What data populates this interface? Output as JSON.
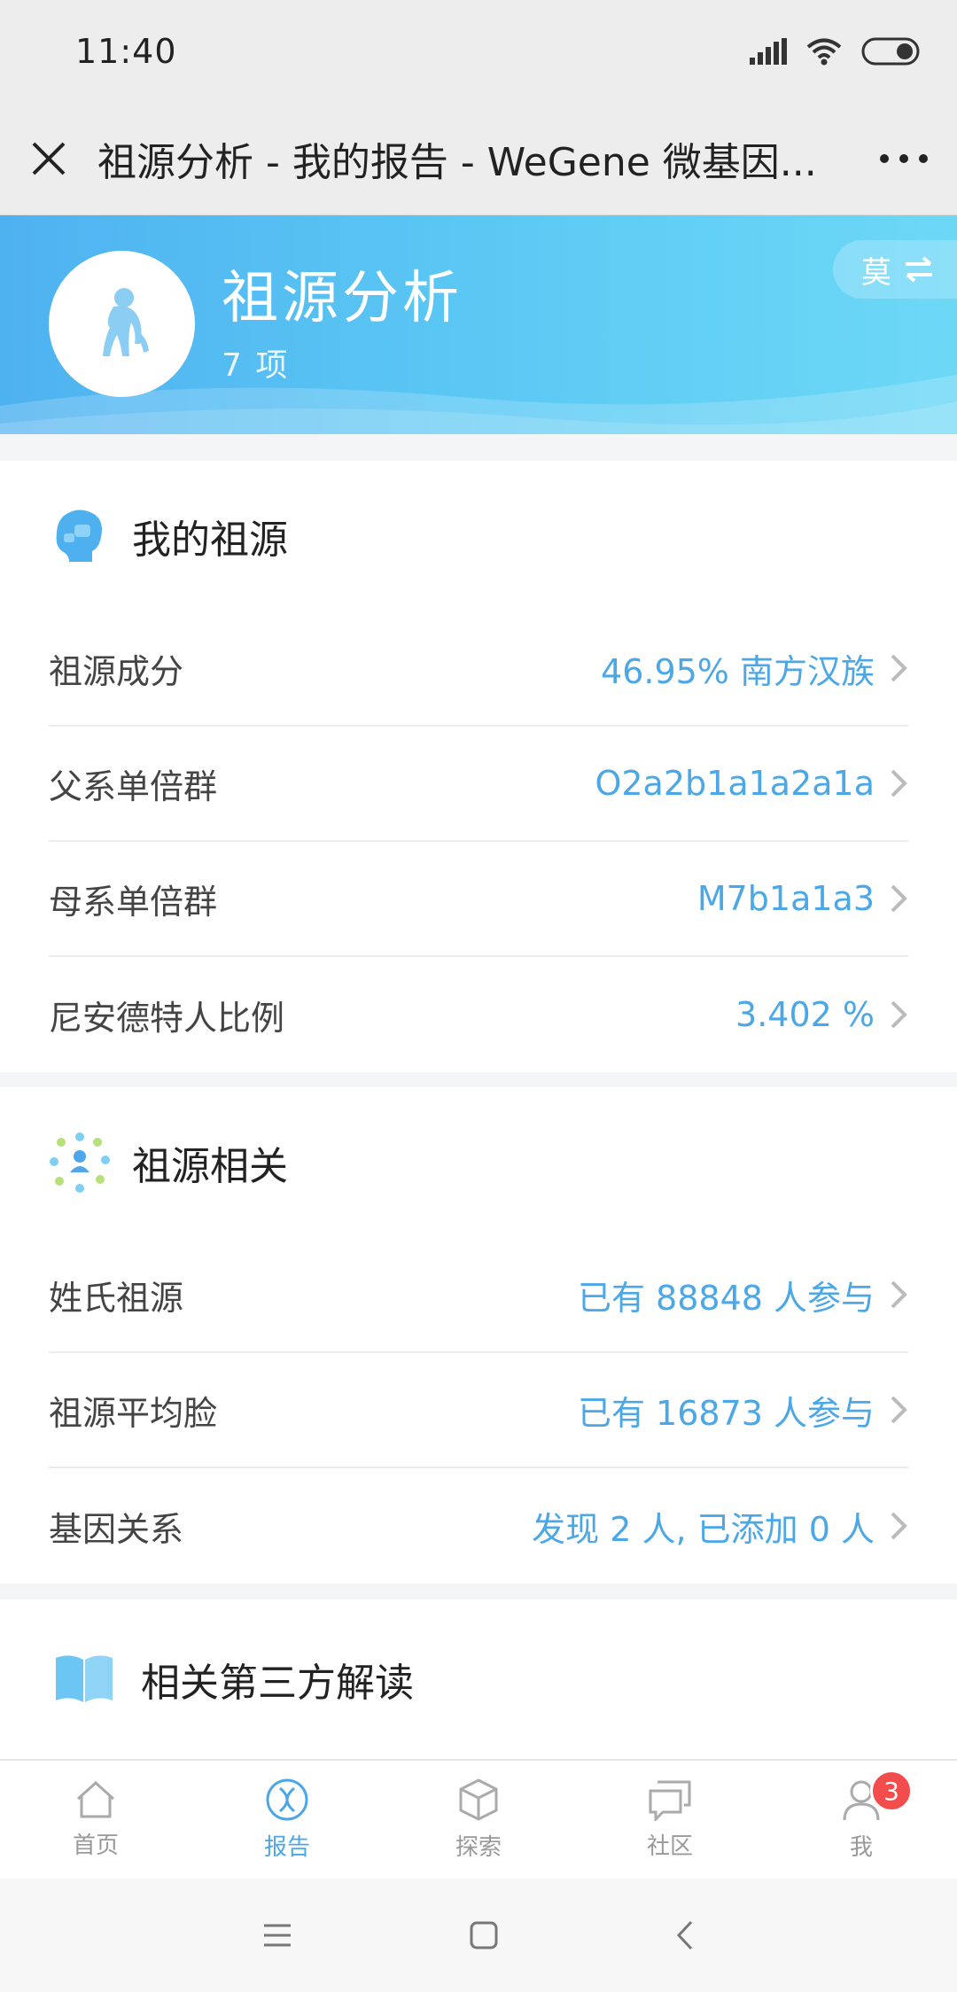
{
  "status": {
    "time": "11:40"
  },
  "titlebar": {
    "title": "祖源分析 - 我的报告 - WeGene 微基因..."
  },
  "banner": {
    "title": "祖源分析",
    "count": "7 项",
    "switch_label": "莫"
  },
  "section_ancestry": {
    "title": "我的祖源",
    "rows": [
      {
        "label": "祖源成分",
        "value": "46.95% 南方汉族"
      },
      {
        "label": "父系单倍群",
        "value": "O2a2b1a1a2a1a"
      },
      {
        "label": "母系单倍群",
        "value": "M7b1a1a3"
      },
      {
        "label": "尼安德特人比例",
        "value": "3.402 %"
      }
    ]
  },
  "section_related": {
    "title": "祖源相关",
    "rows": [
      {
        "label": "姓氏祖源",
        "value": "已有 88848 人参与"
      },
      {
        "label": "祖源平均脸",
        "value": "已有 16873 人参与"
      },
      {
        "label": "基因关系",
        "value": "发现 2 人, 已添加 0 人"
      }
    ]
  },
  "section_third": {
    "title": "相关第三方解读"
  },
  "tabs": [
    {
      "label": "首页",
      "icon": "home-icon"
    },
    {
      "label": "报告",
      "icon": "dna-icon"
    },
    {
      "label": "探索",
      "icon": "cube-icon"
    },
    {
      "label": "社区",
      "icon": "chat-icon"
    },
    {
      "label": "我",
      "icon": "user-icon",
      "badge": "3"
    }
  ],
  "colors": {
    "accent": "#4ca7e6",
    "banner": "#5ccaf4",
    "badge": "#f24c4c"
  }
}
